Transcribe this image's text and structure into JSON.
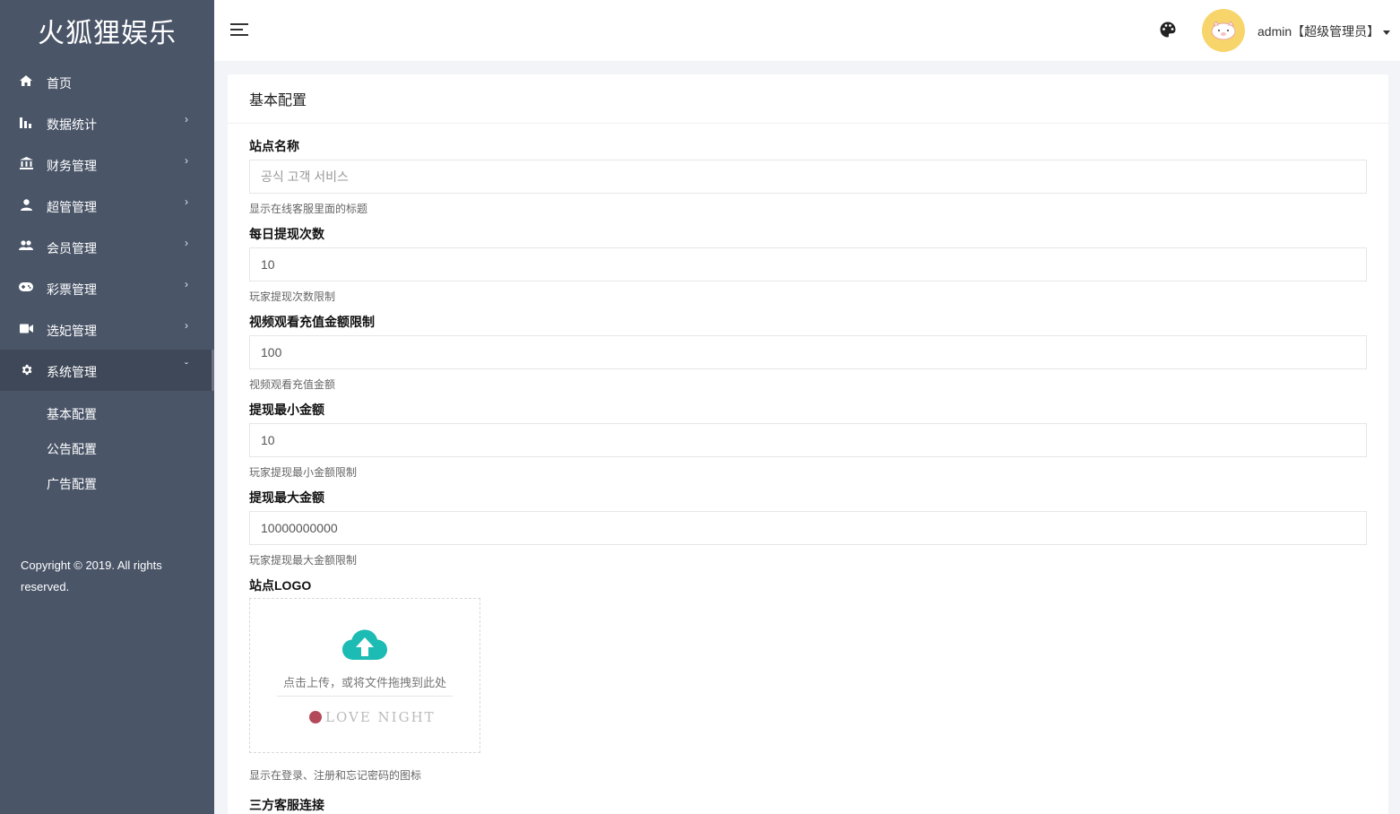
{
  "brand": "火狐狸娱乐",
  "sidebar": {
    "items": [
      {
        "label": "首页",
        "icon": "home-icon",
        "arrow": ""
      },
      {
        "label": "数据统计",
        "icon": "bar-chart-icon",
        "arrow": "›"
      },
      {
        "label": "财务管理",
        "icon": "bank-icon",
        "arrow": "›"
      },
      {
        "label": "超管管理",
        "icon": "person-icon",
        "arrow": "›"
      },
      {
        "label": "会员管理",
        "icon": "group-icon",
        "arrow": "›"
      },
      {
        "label": "彩票管理",
        "icon": "gamepad-icon",
        "arrow": "›"
      },
      {
        "label": "选妃管理",
        "icon": "video-icon",
        "arrow": "›"
      },
      {
        "label": "系统管理",
        "icon": "gear-icon",
        "arrow": "ˇ"
      }
    ],
    "submenu": [
      "基本配置",
      "公告配置",
      "广告配置"
    ],
    "copyright": "Copyright © 2019. All rights reserved."
  },
  "header": {
    "user_label": "admin【超级管理员】"
  },
  "card": {
    "title": "基本配置",
    "fields": [
      {
        "label": "站点名称",
        "value": "",
        "placeholder": "공식 고객 서비스",
        "help": "显示在线客服里面的标题"
      },
      {
        "label": "每日提现次数",
        "value": "10",
        "placeholder": "",
        "help": "玩家提现次数限制"
      },
      {
        "label": "视频观看充值金额限制",
        "value": "100",
        "placeholder": "",
        "help": "视频观看充值金额"
      },
      {
        "label": "提现最小金额",
        "value": "10",
        "placeholder": "",
        "help": "玩家提现最小金额限制"
      },
      {
        "label": "提现最大金额",
        "value": "10000000000",
        "placeholder": "",
        "help": "玩家提现最大金额限制"
      }
    ],
    "logo": {
      "label": "站点LOGO",
      "upload_text": "点击上传，或将文件拖拽到此处",
      "preview_text": "LOVE NIGHT",
      "help": "显示在登录、注册和忘记密码的图标"
    },
    "next_section": "三方客服连接"
  },
  "colors": {
    "sidebar_bg": "#4a5568",
    "accent": "#1cbbb4",
    "avatar_bg": "#f8d56a"
  }
}
